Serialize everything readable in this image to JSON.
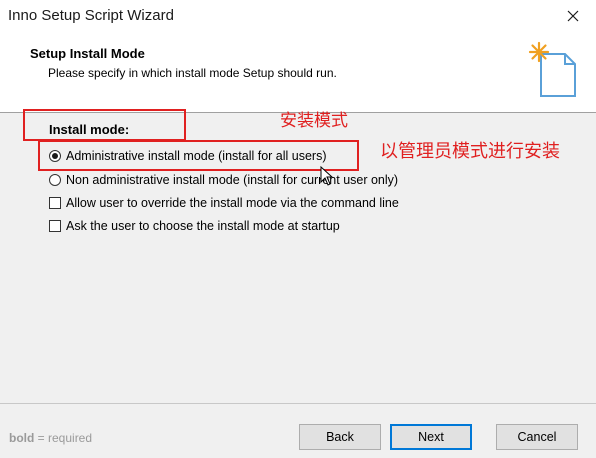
{
  "window": {
    "title": "Inno Setup Script Wizard"
  },
  "header": {
    "title": "Setup Install Mode",
    "subtitle": "Please specify in which install mode Setup should run."
  },
  "main": {
    "install_mode_label": "Install mode:",
    "options": [
      {
        "label": "Administrative install mode (install for all users)",
        "type": "radio",
        "checked": true
      },
      {
        "label": "Non administrative install mode (install for current user only)",
        "type": "radio",
        "checked": false
      },
      {
        "label": "Allow user to override the install mode via the command line",
        "type": "checkbox",
        "checked": false
      },
      {
        "label": "Ask the user to choose the install mode at startup",
        "type": "checkbox",
        "checked": false
      }
    ]
  },
  "annotations": {
    "install_mode_note": "安装模式",
    "admin_mode_note": "以管理员模式进行安装",
    "color": "#e02020"
  },
  "footer": {
    "hint_bold": "bold",
    "hint_rest": " = required",
    "back_label": "Back",
    "next_label": "Next",
    "cancel_label": "Cancel"
  },
  "colors": {
    "accent": "#0078d7",
    "body_bg": "#f0f0f0"
  }
}
